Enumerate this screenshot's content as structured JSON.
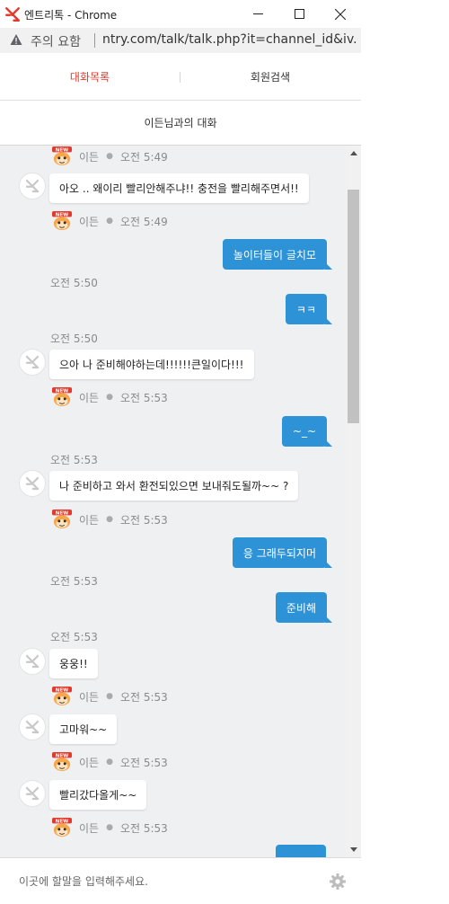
{
  "window": {
    "title": "엔트리톡 - Chrome",
    "icon": "entry-talk-logo",
    "controls": {
      "minimize": "minimize-icon",
      "maximize": "maximize-icon",
      "close": "close-icon"
    }
  },
  "addressbar": {
    "security_label": "주의 요함",
    "url": "ntry.com/talk/talk.php?it=channel_id&iv..."
  },
  "tabs": [
    {
      "label": "대화목록",
      "active": true
    },
    {
      "label": "회원검색",
      "active": false
    }
  ],
  "conversation_title": "이든님과의 대화",
  "chat": {
    "incoming_meta": [
      {
        "name": "이든",
        "time": "오전 5:49"
      },
      {
        "name": "이든",
        "time": "오전 5:49"
      },
      {
        "name": "이든",
        "time": "오전 5:53"
      },
      {
        "name": "이든",
        "time": "오전 5:53"
      },
      {
        "name": "이든",
        "time": "오전 5:53"
      },
      {
        "name": "이든",
        "time": "오전 5:53"
      },
      {
        "name": "이든",
        "time": "오전 5:53"
      }
    ],
    "incoming": [
      "아오 .. 왜이리 빨리안해주냐!! 충전을 빨리해주면서!!",
      "으아 나 준비해야하는데!!!!!!큰일이다!!!",
      "나 준비하고 와서 환전되있으면 보내줘도될까~~ ?",
      "웅웅!!",
      "고마워~~",
      "빨리갔다올게~~"
    ],
    "outgoing": [
      "놀이터들이 글치모",
      "ㅋㅋ",
      "~_~",
      "응 그래두되지머",
      "준비해"
    ],
    "outgoing_times": [
      "오전 5:50",
      "오전 5:50",
      "오전 5:53",
      "오전 5:53",
      "오전 5:53"
    ],
    "badge_text": "NEW"
  },
  "input": {
    "placeholder": "이곳에 할말을 입력해주세요.",
    "settings_icon": "gear-icon"
  },
  "colors": {
    "accent_red": "#e23b2d",
    "outgoing_bubble": "#2e93d6",
    "chat_background": "#eef0f1"
  }
}
